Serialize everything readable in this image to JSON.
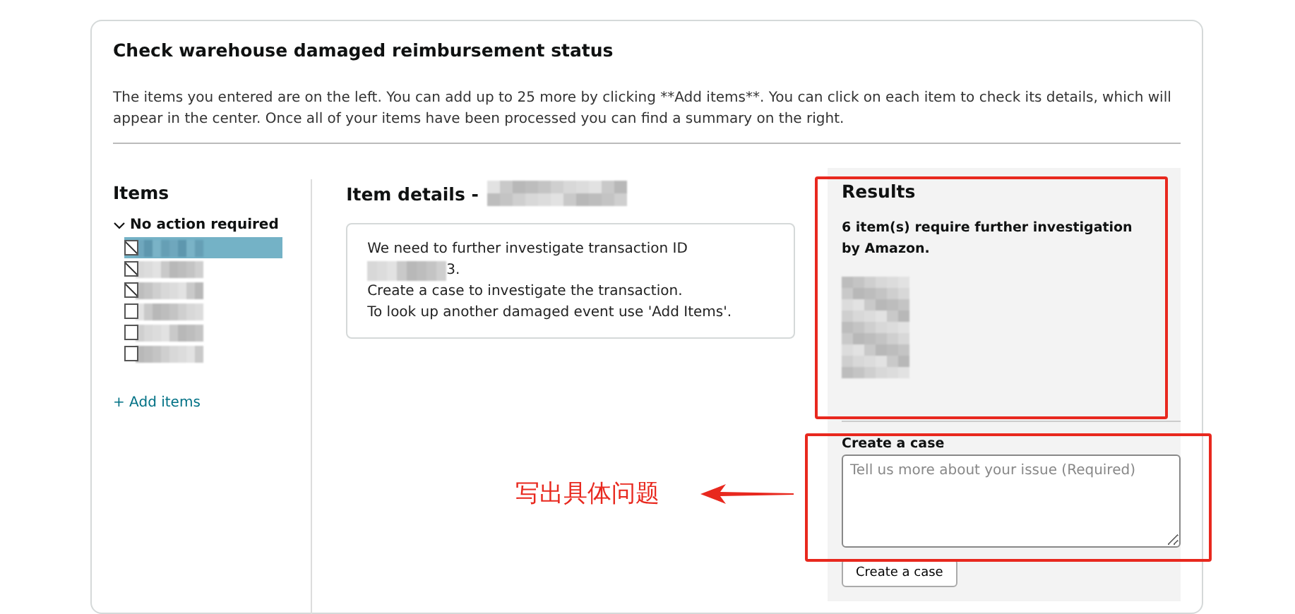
{
  "page": {
    "title": "Check warehouse damaged reimbursement status",
    "description": "The items you entered are on the left. You can add up to 25 more by clicking **Add items**. You can click on each item to check its details, which will appear in the center. Once all of your items have been processed you can find a summary on the right."
  },
  "items_panel": {
    "heading": "Items",
    "group": {
      "label": "No action required",
      "expanded": true
    },
    "items": [
      {
        "selected": true,
        "checked": true
      },
      {
        "selected": false,
        "checked": true
      },
      {
        "selected": false,
        "checked": true
      },
      {
        "selected": false,
        "checked": false
      },
      {
        "selected": false,
        "checked": false
      },
      {
        "selected": false,
        "checked": false
      }
    ],
    "add_link": "+ Add items"
  },
  "details": {
    "heading": "Item details -",
    "message_lines": [
      "We need to further investigate transaction ID",
      "3.",
      "Create a case to investigate the transaction.",
      "To look up another damaged event use 'Add Items'."
    ]
  },
  "results": {
    "heading": "Results",
    "summary": "6 item(s) require further investigation by Amazon."
  },
  "create_case": {
    "label": "Create a case",
    "placeholder": "Tell us more about your issue (Required)",
    "button": "Create a case"
  },
  "annotation": {
    "text": "写出具体问题"
  }
}
